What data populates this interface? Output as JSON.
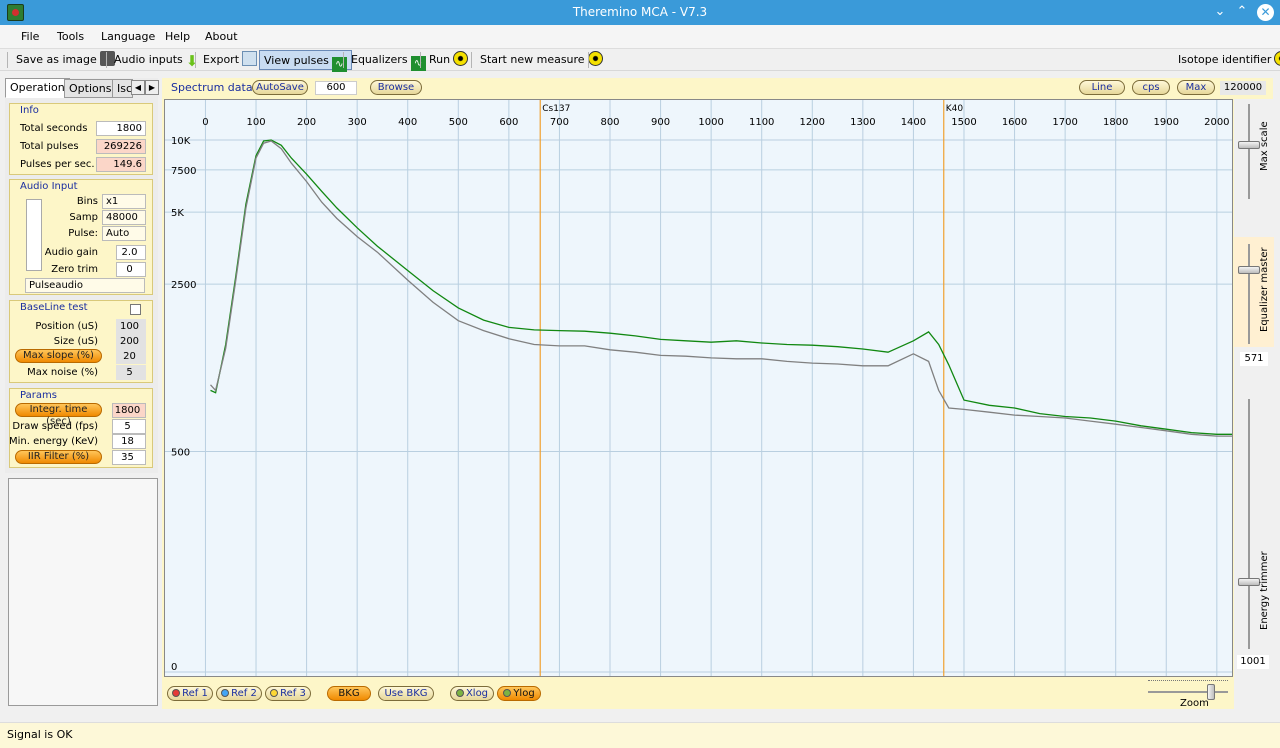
{
  "window": {
    "title": "Theremino MCA - V7.3"
  },
  "menu": [
    "File",
    "Tools",
    "Language",
    "Help",
    "About"
  ],
  "toolbar": {
    "save_image": "Save as image",
    "audio_inputs": "Audio inputs",
    "export": "Export",
    "view_pulses": "View pulses",
    "equalizers": "Equalizers",
    "run": "Run",
    "start_new": "Start new measure",
    "isotope_identifier": "Isotope identifier"
  },
  "tabs": {
    "operation": "Operation",
    "options": "Options",
    "iso": "Isc"
  },
  "info": {
    "title": "Info",
    "total_seconds_label": "Total seconds",
    "total_seconds": "1800",
    "total_pulses_label": "Total pulses",
    "total_pulses": "269226",
    "pps_label": "Pulses per sec.",
    "pps": "149.6"
  },
  "audio": {
    "title": "Audio Input",
    "bins_label": "Bins",
    "bins": "x1",
    "samp_label": "Samp",
    "samp": "48000",
    "pulse_label": "Pulse:",
    "pulse": "Auto",
    "gain_label": "Audio gain",
    "gain": "2.0",
    "zero_label": "Zero trim",
    "zero": "0",
    "device": "Pulseaudio"
  },
  "baseline": {
    "title": "BaseLine test",
    "position_label": "Position (uS)",
    "position": "100",
    "size_label": "Size (uS)",
    "size": "200",
    "maxslope_label": "Max slope (%)",
    "maxslope": "20",
    "maxnoise_label": "Max noise (%)",
    "maxnoise": "5"
  },
  "params": {
    "title": "Params",
    "integr_label": "Integr. time (sec)",
    "integr": "1800",
    "draw_label": "Draw speed (fps)",
    "draw": "5",
    "minenergy_label": "Min. energy (KeV)",
    "minenergy": "18",
    "iir_label": "IIR Filter (%)",
    "iir": "35"
  },
  "spectrum_head": {
    "title": "Spectrum data",
    "autosave": "AutoSave",
    "autosave_value": "600",
    "browse": "Browse",
    "line": "Line",
    "cps": "cps",
    "max": "Max",
    "max_value": "120000"
  },
  "right_panel": {
    "max_scale": "Max scale",
    "equalizer_master": "Equalizer master",
    "eq_value": "571",
    "energy_trimmer": "Energy trimmer",
    "energy_value": "1001",
    "zoom_value": "802",
    "zoom_label": "Zoom"
  },
  "bottom_buttons": {
    "ref1": "Ref 1",
    "ref2": "Ref 2",
    "ref3": "Ref 3",
    "bkg": "BKG",
    "use_bkg": "Use BKG",
    "xlog": "Xlog",
    "ylog": "Ylog"
  },
  "status": "Signal is OK",
  "colors": {
    "green_series": "#118811",
    "grey_series": "#808080",
    "marker": "#f0a030",
    "panel": "#fdf6c8",
    "plot_bg": "#eef6fc"
  },
  "chart_data": {
    "type": "line",
    "xlabel": "",
    "ylabel": "",
    "xlim": [
      -80,
      2030
    ],
    "x_ticks": [
      0,
      100,
      200,
      300,
      400,
      500,
      600,
      700,
      800,
      900,
      1000,
      1100,
      1200,
      1300,
      1400,
      1500,
      1600,
      1700,
      1800,
      1900,
      2000
    ],
    "y_ticks": [
      {
        "label": "10K",
        "value": 10000
      },
      {
        "label": "7500",
        "value": 7500
      },
      {
        "label": "5K",
        "value": 5000
      },
      {
        "label": "2500",
        "value": 2500
      },
      {
        "label": "500",
        "value": 500
      },
      {
        "label": "0",
        "value": 0
      }
    ],
    "y_scale": "log",
    "grid": true,
    "markers": [
      {
        "label": "Cs137",
        "x": 662
      },
      {
        "label": "K40",
        "x": 1460
      }
    ],
    "series": [
      {
        "x": [
          10,
          20,
          40,
          60,
          80,
          100,
          115,
          130,
          150,
          170,
          200,
          230,
          260,
          300,
          340,
          400,
          450,
          500,
          550,
          600,
          650,
          700,
          750,
          800,
          850,
          900,
          950,
          1000,
          1050,
          1100,
          1150,
          1200,
          1250,
          1300,
          1350,
          1400,
          1430,
          1450,
          1470,
          1500,
          1550,
          1600,
          1650,
          1700,
          1750,
          1800,
          1850,
          1900,
          1950,
          2000,
          2030
        ],
        "y": [
          900,
          880,
          1400,
          2700,
          5400,
          8600,
          9900,
          10000,
          9500,
          8400,
          7200,
          6100,
          5200,
          4300,
          3600,
          2850,
          2350,
          1990,
          1770,
          1650,
          1610,
          1600,
          1590,
          1560,
          1520,
          1470,
          1450,
          1430,
          1450,
          1420,
          1400,
          1390,
          1370,
          1340,
          1300,
          1450,
          1580,
          1400,
          1150,
          820,
          780,
          760,
          720,
          700,
          690,
          670,
          640,
          620,
          600,
          590,
          590
        ]
      },
      {
        "x": [
          10,
          20,
          40,
          60,
          80,
          100,
          115,
          130,
          150,
          170,
          200,
          230,
          260,
          300,
          340,
          400,
          450,
          500,
          550,
          600,
          650,
          700,
          750,
          800,
          850,
          900,
          950,
          1000,
          1050,
          1100,
          1150,
          1200,
          1250,
          1300,
          1350,
          1400,
          1430,
          1450,
          1470,
          1500,
          1550,
          1600,
          1650,
          1700,
          1750,
          1800,
          1850,
          1900,
          1950,
          2000,
          2030
        ],
        "y": [
          950,
          900,
          1350,
          2600,
          5200,
          8400,
          9700,
          9900,
          9200,
          8000,
          6700,
          5500,
          4700,
          3950,
          3400,
          2600,
          2100,
          1760,
          1600,
          1480,
          1400,
          1380,
          1380,
          1330,
          1300,
          1260,
          1250,
          1230,
          1220,
          1220,
          1190,
          1170,
          1160,
          1140,
          1140,
          1280,
          1190,
          900,
          760,
          750,
          730,
          710,
          700,
          690,
          670,
          650,
          630,
          610,
          590,
          580,
          580
        ]
      }
    ]
  }
}
